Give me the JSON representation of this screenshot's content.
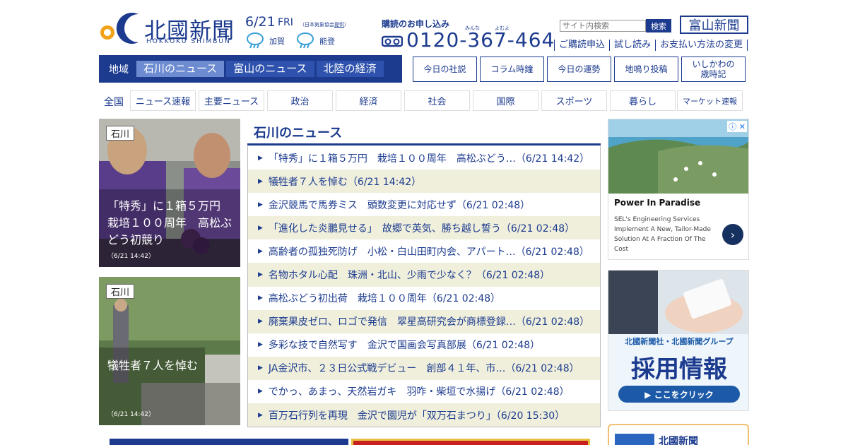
{
  "header": {
    "logo_jp": "北國新聞",
    "logo_en": "HOKKOKU SHIMBUN",
    "date": "6/21",
    "weekday": "FRI",
    "weather_source_prefix": "（日本気象協会",
    "weather_source_link": "提供",
    "weather_source_suffix": "）",
    "weather": [
      {
        "place": "加賀",
        "icon": "cloud-rain-icon"
      },
      {
        "place": "能登",
        "icon": "cloud-rain-icon"
      }
    ],
    "subscribe_title": "購読のお申し込み",
    "phone_ruby": "みんな　　　よむよ",
    "phone": "0120-367-464",
    "search_placeholder": "サイト内検索",
    "search_button": "検索",
    "toyama_logo": "富山新聞",
    "sublinks": [
      "ご購読申込",
      "試し読み",
      "お支払い方法の変更"
    ]
  },
  "region_nav": {
    "label": "地域",
    "tabs": [
      {
        "label": "石川のニュース",
        "active": true
      },
      {
        "label": "富山のニュース",
        "active": false
      },
      {
        "label": "北陸の経済",
        "active": false
      }
    ]
  },
  "right_buttons": [
    "今日の社説",
    "コラム時鐘",
    "今日の運勢",
    "地鳴り投稿",
    "いしかわの\n歳時記"
  ],
  "category_nav": {
    "label": "全国",
    "items": [
      "ニュース速報",
      "主要ニュース",
      "政治",
      "経済",
      "社会",
      "国際",
      "スポーツ",
      "暮らし",
      "マーケット速報"
    ]
  },
  "photo_cards": [
    {
      "tag": "石川",
      "caption": "「特秀」に１箱５万円　栽培１００周年　高松ぶどう初競り",
      "time": "（6/21 14:42）"
    },
    {
      "tag": "石川",
      "caption": "犠牲者７人を悼む",
      "time": "（6/21 14:42）"
    }
  ],
  "news": {
    "title": "石川のニュース",
    "items": [
      "「特秀」に１箱５万円　栽培１００周年　高松ぶどう…（6/21 14:42）",
      "犠牲者７人を悼む（6/21 14:42）",
      "金沢競馬で馬券ミス　頭数変更に対応せず（6/21 02:48）",
      "「進化した炎鵬見せる」　故郷で英気、勝ち越し誓う（6/21 02:48）",
      "高齢者の孤独死防げ　小松・白山田町内会、アパート…（6/21 02:48）",
      "名物ホタル心配　珠洲・北山、少雨で少なく？（6/21 02:48）",
      "高松ぶどう初出荷　栽培１００周年（6/21 02:48）",
      "廃棄果皮ゼロ、ロゴで発信　翠星高研究会が商標登録…（6/21 02:48）",
      "多彩な技で自然写す　金沢で国画会写真部展（6/21 02:48）",
      "JA金沢市、２３日公式戦デビュー　創部４１年、市…（6/21 02:48）",
      "でかっ、あまっ、天然岩ガキ　羽咋・柴垣で水揚げ（6/21 02:48）",
      "百万石行列を再現　金沢で園児が「双万石まつり」（6/20 15:30）"
    ]
  },
  "ads": {
    "ad1": {
      "headline": "Power In Paradise",
      "body": "SEL's Engineering Services Implement A New, Tailor-Made Solution At A Fraction Of The Cost"
    },
    "ad2": {
      "company": "北國新聞社・北國新聞グループ",
      "title": "採用情報",
      "cta": "▶ ここをクリック"
    },
    "ad3": {
      "title": "北國新聞"
    }
  }
}
